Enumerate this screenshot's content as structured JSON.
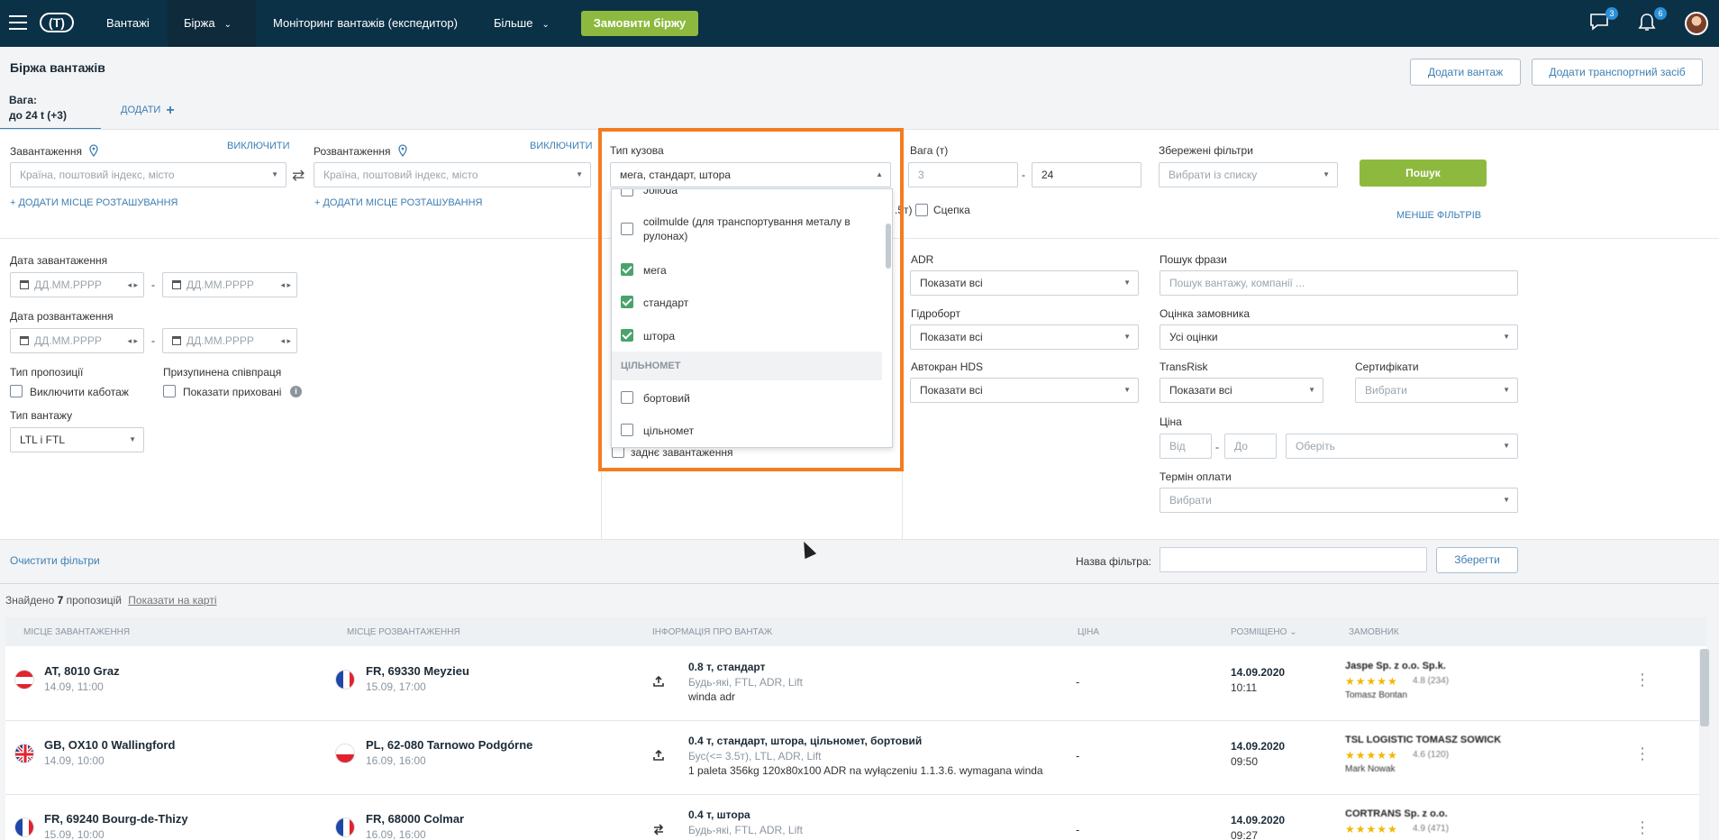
{
  "topnav": {
    "items": [
      "Вантажі",
      "Біржа",
      "Моніторинг вантажів (експедитор)",
      "Більше"
    ],
    "order_button": "Замовити біржу",
    "messages_badge": "3",
    "notifications_badge": "6",
    "logo_text": "(T)"
  },
  "header": {
    "title": "Біржа вантажів",
    "add_cargo": "Додати вантаж",
    "add_vehicle": "Додати транспортний засіб",
    "tab_weight_label": "Вага:",
    "tab_weight_value": "до 24 t (+3)",
    "tab_add": "ДОДАТИ"
  },
  "filters": {
    "loading": {
      "label": "Завантаження",
      "toggle": "ВИКЛЮЧИТИ",
      "placeholder": "Країна, поштовий індекс, місто",
      "add_place": "+ ДОДАТИ МІСЦЕ РОЗТАШУВАННЯ"
    },
    "unloading": {
      "label": "Розвантаження",
      "toggle": "ВИКЛЮЧИТИ",
      "placeholder": "Країна, поштовий індекс, місто",
      "add_place": "+ ДОДАТИ МІСЦЕ РОЗТАШУВАННЯ"
    },
    "body_type": {
      "label": "Тип кузова",
      "value": "мега, стандарт, штора"
    },
    "weight": {
      "label": "Вага (т)",
      "from": "3",
      "to": "24",
      "dash": "-"
    },
    "saved_filters": {
      "label": "Збережені фільтри",
      "placeholder": "Вибрати із списку"
    },
    "search_button": "Пошук",
    "fewer_filters": "МЕНШЕ ФІЛЬТРІВ",
    "trailer": {
      "fragment": ".5т)",
      "label": "Сцепка"
    },
    "loading_date": {
      "label": "Дата завантаження",
      "from": "ДД.ММ.РРРР",
      "to": "ДД.ММ.РРРР"
    },
    "unloading_date": {
      "label": "Дата розвантаження",
      "from": "ДД.ММ.РРРР",
      "to": "ДД.ММ.РРРР"
    },
    "offer_type": {
      "label": "Тип пропозиції",
      "checkbox": "Виключити каботаж"
    },
    "suspended": {
      "label": "Призупинена співпраця",
      "checkbox": "Показати приховані"
    },
    "cargo_type": {
      "label": "Тип вантажу",
      "value": "LTL і FTL"
    },
    "adr": {
      "label": "ADR",
      "value": "Показати всі"
    },
    "hydroboard": {
      "label": "Гідроборт",
      "value": "Показати всі"
    },
    "crane": {
      "label": "Автокран HDS",
      "value": "Показати всі"
    },
    "phrase": {
      "label": "Пошук фрази",
      "placeholder": "Пошук вантажу, компанії ..."
    },
    "customer_rating": {
      "label": "Оцінка замовника",
      "value": "Усі оцінки"
    },
    "transrisk": {
      "label": "TransRisk",
      "value": "Показати всі"
    },
    "certificates": {
      "label": "Сертифікати",
      "placeholder": "Вибрати"
    },
    "price": {
      "label": "Ціна",
      "from": "Від",
      "to": "До",
      "currency": "Оберіть"
    },
    "payment_term": {
      "label": "Термін оплати",
      "placeholder": "Вибрати"
    },
    "rear_loading": "заднє завантаження",
    "clear": "Очистити фільтри",
    "filter_name_label": "Назва фільтра:",
    "save": "Зберегти"
  },
  "dropdown": {
    "options": [
      {
        "label": "Jolloda",
        "checked": false
      },
      {
        "label": "coilmulde (для транспортування металу в рулонах)",
        "checked": false
      },
      {
        "label": "мега",
        "checked": true
      },
      {
        "label": "стандарт",
        "checked": true
      },
      {
        "label": "штора",
        "checked": true
      }
    ],
    "group": "ЦІЛЬНОМЕТ",
    "group_options": [
      {
        "label": "бортовий",
        "checked": false
      },
      {
        "label": "цільномет",
        "checked": false
      }
    ]
  },
  "results": {
    "found_prefix": "Знайдено",
    "found_count": "7",
    "found_suffix": "пропозицій",
    "map_link": "Показати на карті",
    "columns": [
      "Місце завантаження",
      "Місце розвантаження",
      "Інформація про вантаж",
      "Ціна",
      "Розміщено",
      "Замовник"
    ],
    "rows": [
      {
        "from_city": "AT, 8010 Graz",
        "from_date": "14.09, 11:00",
        "to_city": "FR, 69330 Meyzieu",
        "to_date": "15.09, 17:00",
        "cargo_title": "0.8 т, стандарт",
        "cargo_sub": "Будь-які, FTL, ADR, Lift",
        "cargo_note": "winda adr",
        "price": "-",
        "posted_date": "14.09.2020",
        "posted_time": "10:11",
        "customer": "Jaspe Sp. z o.o. Sp.k.",
        "rating": "4.8 (234)",
        "contact": "Tomasz Bontan"
      },
      {
        "from_city": "GB, OX10 0 Wallingford",
        "from_date": "14.09, 10:00",
        "to_city": "PL, 62-080 Tarnowo Podgórne",
        "to_date": "16.09, 16:00",
        "cargo_title": "0.4 т, стандарт, штора, цільномет, бортовий",
        "cargo_sub": "Бус(<= 3.5т), LTL, ADR, Lift",
        "cargo_note": "1 paleta 356kg 120x80x100 ADR na wyłączeniu 1.1.3.6. wymagana winda",
        "price": "-",
        "posted_date": "14.09.2020",
        "posted_time": "09:50",
        "customer": "TSL LOGISTIC TOMASZ SOWICK",
        "rating": "4.6 (120)",
        "contact": "Mark Nowak"
      },
      {
        "from_city": "FR, 69240 Bourg-de-Thizy",
        "from_date": "15.09, 10:00",
        "to_city": "FR, 68000 Colmar",
        "to_date": "16.09, 16:00",
        "cargo_title": "0.4 т, штора",
        "cargo_sub": "Будь-які, FTL, ADR, Lift",
        "cargo_note": "",
        "price": "-",
        "posted_date": "14.09.2020",
        "posted_time": "09:27",
        "customer": "CORTRANS Sp. z o.o.",
        "rating": "4.9 (471)",
        "contact": ""
      }
    ]
  }
}
